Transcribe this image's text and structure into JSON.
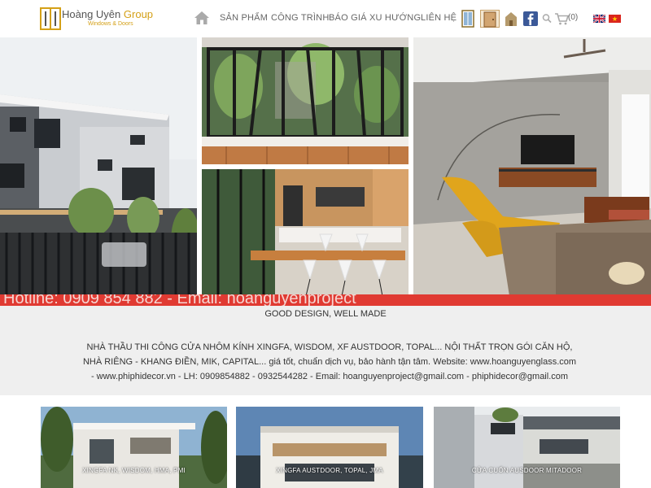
{
  "brand": {
    "name_main": "Hoàng Uyên",
    "name_group": "Group",
    "subtitle": "Windows & Doors"
  },
  "nav": {
    "items": [
      {
        "label": "SẢN PHẨM"
      },
      {
        "label": "CÔNG TRÌNH"
      },
      {
        "label": "BÁO GIÁ"
      },
      {
        "label": "XU HƯỚNG"
      },
      {
        "label": "LIÊN HỆ"
      }
    ],
    "cart_count": "(0)"
  },
  "ticker": {
    "text": "Hotline: 0909 854 882 - Email: hoanguyenproject"
  },
  "intro": {
    "tagline": "GOOD DESIGN, WELL MADE",
    "description": "NHÀ THẦU THI CÔNG CỬA NHÔM KÍNH XINGFA, WISDOM, XF AUSTDOOR, TOPAL... NỘI THẤT TRỌN GÓI CĂN HỘ, NHÀ RIÊNG - KHANG ĐIỀN, MIK, CAPITAL... giá tốt, chuẩn dịch vụ, bảo hành tận tâm. Website: www.hoanguyenglass.com - www.phiphidecor.vn - LH: 0909854882 - 0932544282 - Email: hoanguyenproject@gmail.com - phiphidecor@gmail.com"
  },
  "cards": [
    {
      "label": "XINGFA NK, WISDOM, HMA, PMI"
    },
    {
      "label": "XINGFA AUSTDOOR, TOPAL, JMA"
    },
    {
      "label": "CỬA CUỐN AUSDOOR MITADOOR"
    }
  ],
  "colors": {
    "accent_red": "#e03a32",
    "brand_gold": "#d4a017",
    "nav_text": "#666666",
    "intro_bg": "#efefef"
  },
  "icons": [
    "home-icon",
    "window-icon",
    "door-icon",
    "house-icon",
    "facebook-icon",
    "search-icon",
    "cart-icon",
    "flag-uk-icon",
    "flag-vn-icon"
  ]
}
